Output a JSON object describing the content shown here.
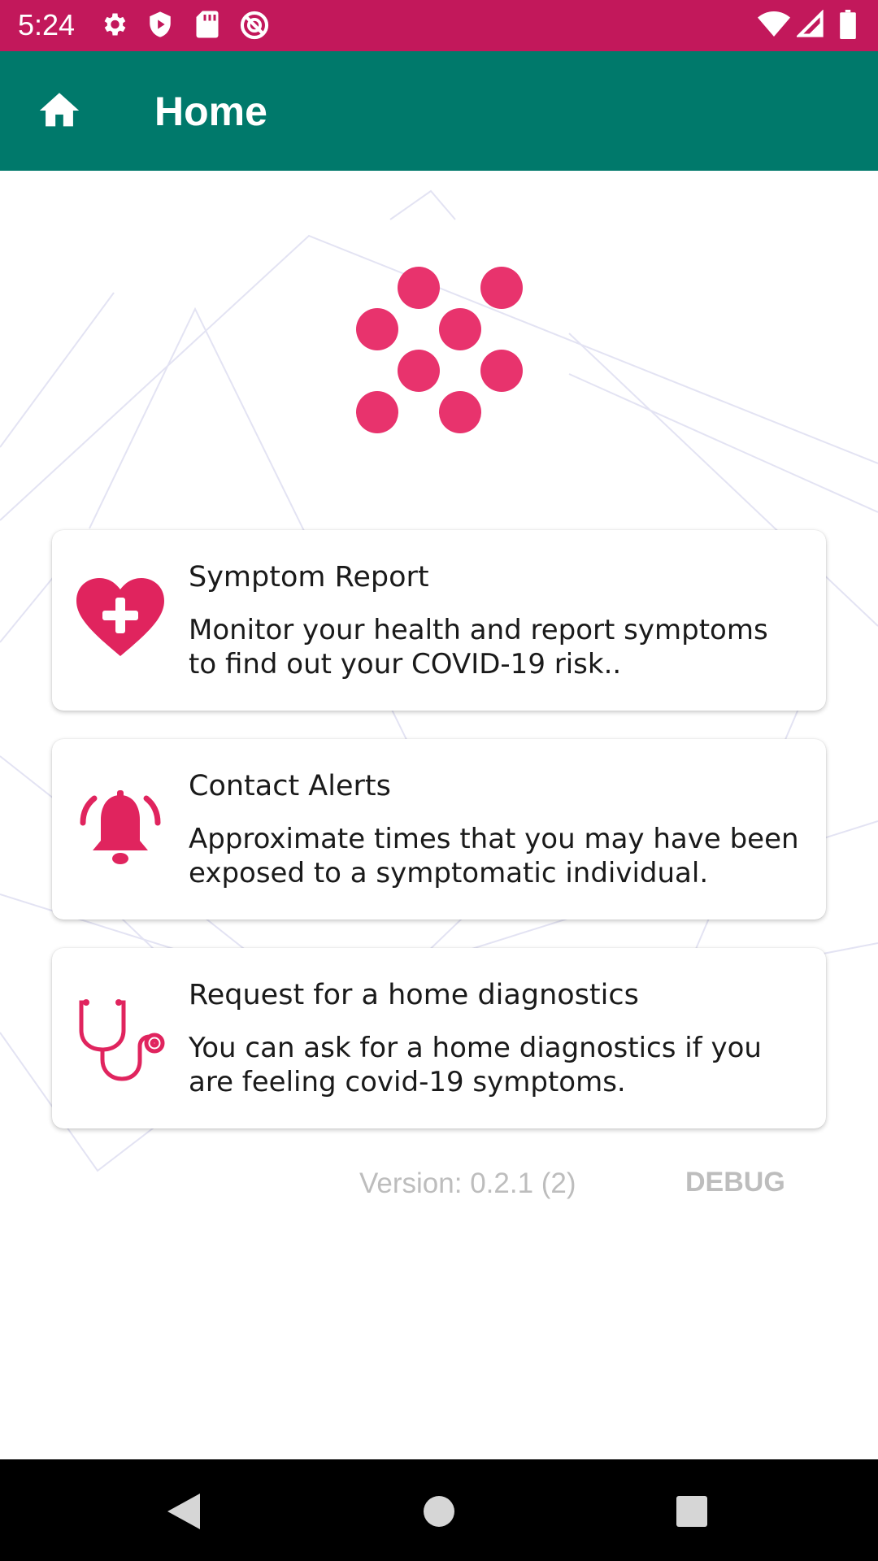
{
  "status_bar": {
    "time": "5:24",
    "left_icons": [
      "gear-icon",
      "shield-play-icon",
      "sd-card-icon",
      "no-sync-icon"
    ],
    "right_icons": [
      "wifi-icon",
      "cell-signal-icon",
      "battery-icon"
    ],
    "color": "#c2185b"
  },
  "app_bar": {
    "title": "Home",
    "icon": "home-icon",
    "color": "#00796b"
  },
  "logo": {
    "icon": "dots-logo-icon",
    "color": "#e8336d"
  },
  "cards": [
    {
      "icon": "heart-plus-icon",
      "title": "Symptom Report",
      "description": "Monitor your health and report symptoms\nto find out your COVID-19 risk.."
    },
    {
      "icon": "bell-alert-icon",
      "title": "Contact Alerts",
      "description": "Approximate times that you may have been\nexposed to a symptomatic individual."
    },
    {
      "icon": "stethoscope-icon",
      "title": "Request for a home diagnostics",
      "description": "You can ask for a home diagnostics if you\nare feeling covid-19 symptoms."
    }
  ],
  "footer": {
    "version": "Version: 0.2.1 (2)",
    "debug_label": "DEBUG"
  },
  "nav_bar": {
    "buttons": [
      "back-icon",
      "home-circle-icon",
      "recents-icon"
    ]
  },
  "accent_color": "#e0245e"
}
